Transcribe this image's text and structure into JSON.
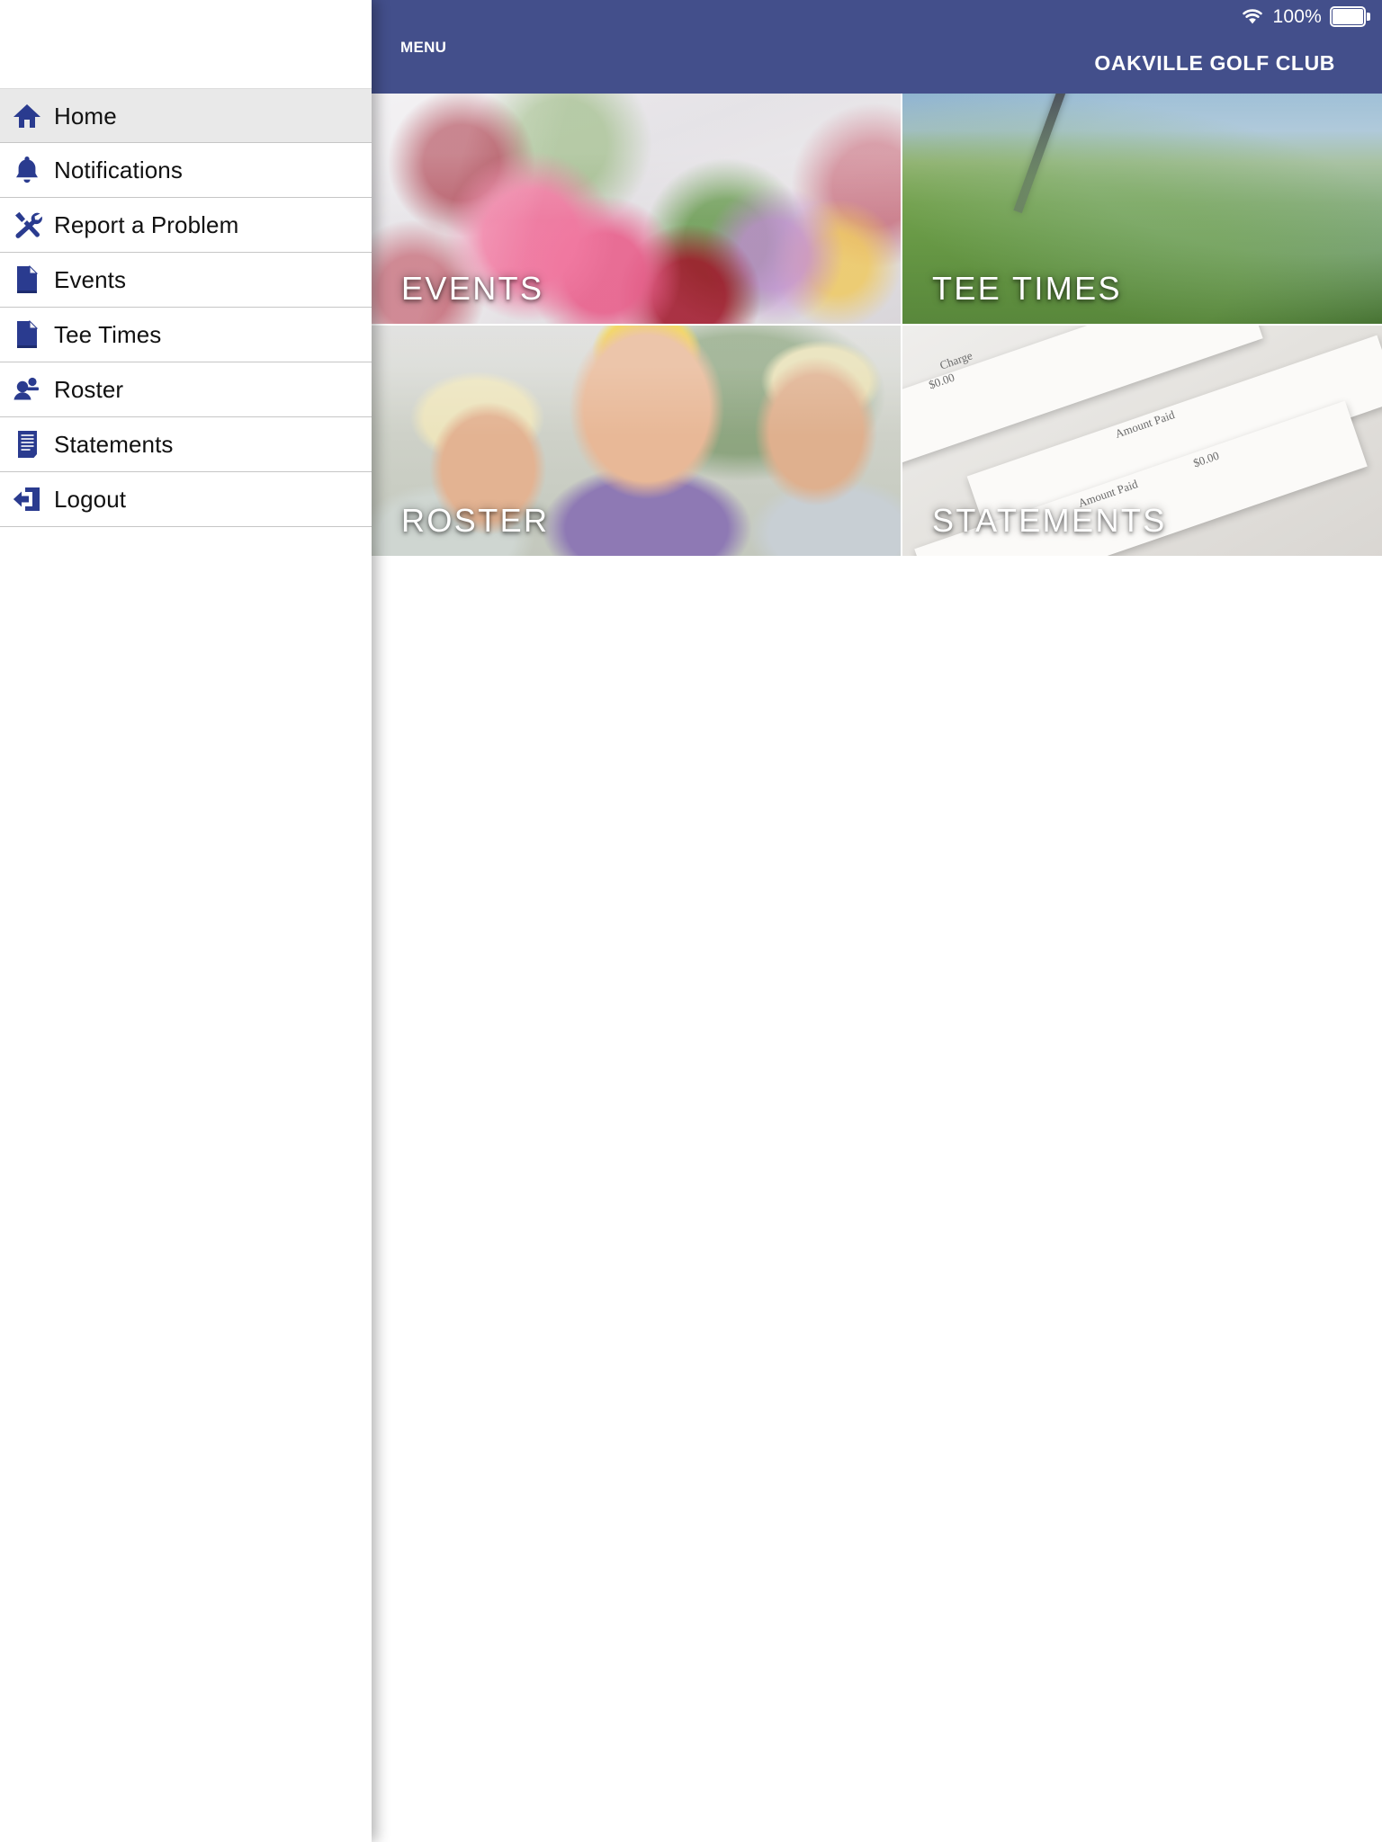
{
  "status_bar": {
    "wifi_icon": "wifi-icon",
    "battery_percent": "100%",
    "battery_icon": "battery-full-icon"
  },
  "app_bar": {
    "menu_icon": "hamburger-menu-icon",
    "menu_label": "MENU",
    "title": "OAKVILLE GOLF CLUB",
    "background_color": "#434F8B"
  },
  "sidebar": {
    "items": [
      {
        "label": "Home",
        "icon": "home-icon",
        "selected": true
      },
      {
        "label": "Notifications",
        "icon": "bell-icon",
        "selected": false
      },
      {
        "label": "Report a Problem",
        "icon": "tools-icon",
        "selected": false
      },
      {
        "label": "Events",
        "icon": "document-icon",
        "selected": false
      },
      {
        "label": "Tee Times",
        "icon": "document-icon",
        "selected": false
      },
      {
        "label": "Roster",
        "icon": "people-icon",
        "selected": false
      },
      {
        "label": "Statements",
        "icon": "receipt-icon",
        "selected": false
      },
      {
        "label": "Logout",
        "icon": "logout-icon",
        "selected": false
      }
    ],
    "icon_color": "#2A3B8F",
    "selected_background": "#E9E9E9"
  },
  "tiles": [
    {
      "label": "EVENTS",
      "image": "banquet-table-flowers-photo"
    },
    {
      "label": "TEE TIMES",
      "image": "golf-club-on-grass-photo"
    },
    {
      "label": "ROSTER",
      "image": "three-smiling-golfers-photo"
    },
    {
      "label": "STATEMENTS",
      "image": "invoice-papers-photo"
    }
  ],
  "statement_paper": {
    "line1": "Charge",
    "line2": "$0.00",
    "line3": "Amount Paid",
    "line4": "$0.00",
    "line5": "Amount Paid"
  }
}
